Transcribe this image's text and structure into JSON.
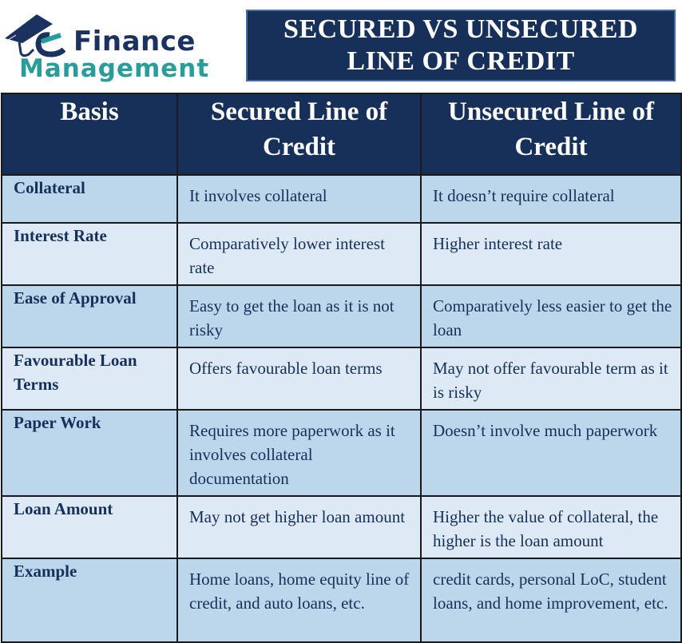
{
  "logo": {
    "icon": "graduation-cap-e-icon",
    "line1": "Finance",
    "line2": "Management",
    "colors": {
      "primary": "#1b3260",
      "secondary": "#2a9d9a"
    }
  },
  "title": {
    "line1": "SECURED VS UNSECURED",
    "line2": "LINE OF CREDIT"
  },
  "table": {
    "headers": {
      "basis": "Basis",
      "secured": "Secured Line of Credit",
      "unsecured": "Unsecured Line of Credit"
    },
    "rows": [
      {
        "basis": "Collateral",
        "secured": "It involves collateral",
        "unsecured": "It doesn’t require collateral"
      },
      {
        "basis": "Interest Rate",
        "secured": "Comparatively lower interest rate",
        "unsecured": "Higher interest rate"
      },
      {
        "basis": "Ease of Approval",
        "secured": "Easy to get the loan as it is not risky",
        "unsecured": "Comparatively less easier to get the loan"
      },
      {
        "basis": "Favourable Loan Terms",
        "secured": "Offers favourable loan terms",
        "unsecured": "May not offer favourable term as it is risky"
      },
      {
        "basis": "Paper Work",
        "secured": "Requires more paperwork as it involves collateral documentation",
        "unsecured": "Doesn’t involve much paperwork"
      },
      {
        "basis": "Loan Amount",
        "secured": "May not get higher loan amount",
        "unsecured": "Higher the value of collateral, the higher is the loan amount"
      },
      {
        "basis": "Example",
        "secured": "Home loans, home equity line of credit, and auto loans, etc.",
        "unsecured": "credit cards, personal LoC, student loans, and home improvement, etc."
      }
    ]
  },
  "colors": {
    "header_bg": "#17305a",
    "row_dark": "#bcd6ec",
    "row_light": "#dde9f5",
    "text": "#17305a"
  }
}
